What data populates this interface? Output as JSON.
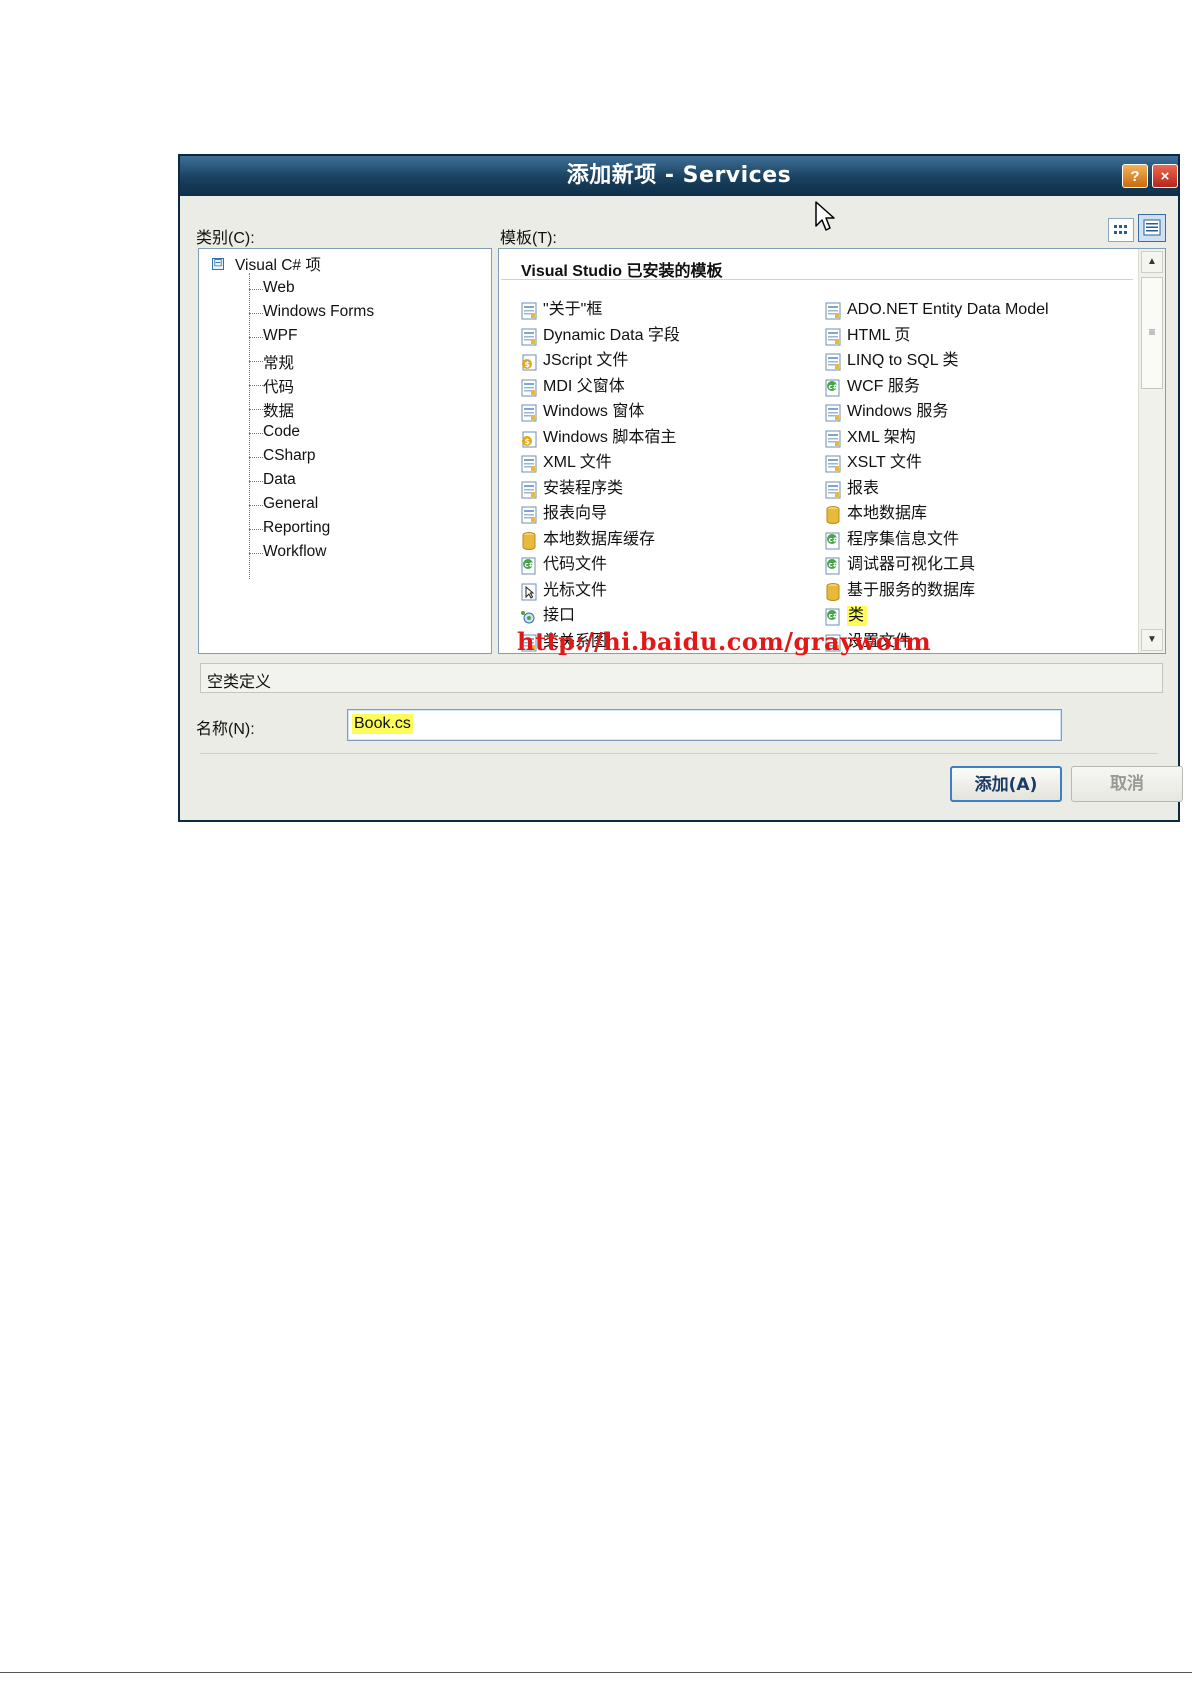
{
  "window": {
    "title": "添加新项 - Services",
    "help_label": "?",
    "close_label": "×"
  },
  "category": {
    "label": "类别(C):",
    "root": "Visual C# 项",
    "expander": "⊟",
    "items": [
      "Web",
      "Windows Forms",
      "WPF",
      "常规",
      "代码",
      "数据",
      "Code",
      "CSharp",
      "Data",
      "General",
      "Reporting",
      "Workflow"
    ]
  },
  "templates": {
    "label": "模板(T):",
    "header": "Visual Studio 已安装的模板",
    "left": [
      {
        "label": "\"关于\"框",
        "icon": "about-box-icon"
      },
      {
        "label": "Dynamic Data 字段",
        "icon": "dynamic-data-icon"
      },
      {
        "label": "JScript 文件",
        "icon": "jscript-icon"
      },
      {
        "label": "MDI 父窗体",
        "icon": "mdi-form-icon"
      },
      {
        "label": "Windows 窗体",
        "icon": "windows-form-icon"
      },
      {
        "label": "Windows 脚本宿主",
        "icon": "script-host-icon"
      },
      {
        "label": "XML 文件",
        "icon": "xml-file-icon"
      },
      {
        "label": "安装程序类",
        "icon": "installer-class-icon"
      },
      {
        "label": "报表向导",
        "icon": "report-wizard-icon"
      },
      {
        "label": "本地数据库缓存",
        "icon": "local-db-cache-icon"
      },
      {
        "label": "代码文件",
        "icon": "code-file-icon"
      },
      {
        "label": "光标文件",
        "icon": "cursor-file-icon"
      },
      {
        "label": "接口",
        "icon": "interface-icon"
      },
      {
        "label": "类关系图",
        "icon": "class-diagram-icon"
      }
    ],
    "right": [
      {
        "label": "ADO.NET Entity Data Model",
        "icon": "entity-model-icon"
      },
      {
        "label": "HTML 页",
        "icon": "html-page-icon"
      },
      {
        "label": "LINQ to SQL 类",
        "icon": "linq-sql-icon"
      },
      {
        "label": "WCF 服务",
        "icon": "wcf-service-icon"
      },
      {
        "label": "Windows 服务",
        "icon": "windows-service-icon"
      },
      {
        "label": "XML 架构",
        "icon": "xml-schema-icon"
      },
      {
        "label": "XSLT 文件",
        "icon": "xslt-file-icon"
      },
      {
        "label": "报表",
        "icon": "report-icon"
      },
      {
        "label": "本地数据库",
        "icon": "local-db-icon"
      },
      {
        "label": "程序集信息文件",
        "icon": "assembly-info-icon"
      },
      {
        "label": "调试器可视化工具",
        "icon": "debugger-visualizer-icon"
      },
      {
        "label": "基于服务的数据库",
        "icon": "service-db-icon"
      },
      {
        "label": "类",
        "icon": "class-icon"
      },
      {
        "label": "设置文件",
        "icon": "settings-file-icon"
      }
    ],
    "selected": "类",
    "scroll_mark": "≡"
  },
  "watermark": "http://hi.baidu.com/grayworm",
  "description": "空类定义",
  "name": {
    "label": "名称(N):",
    "value": "Book.cs"
  },
  "buttons": {
    "add": "添加(A)",
    "cancel": "取消"
  }
}
